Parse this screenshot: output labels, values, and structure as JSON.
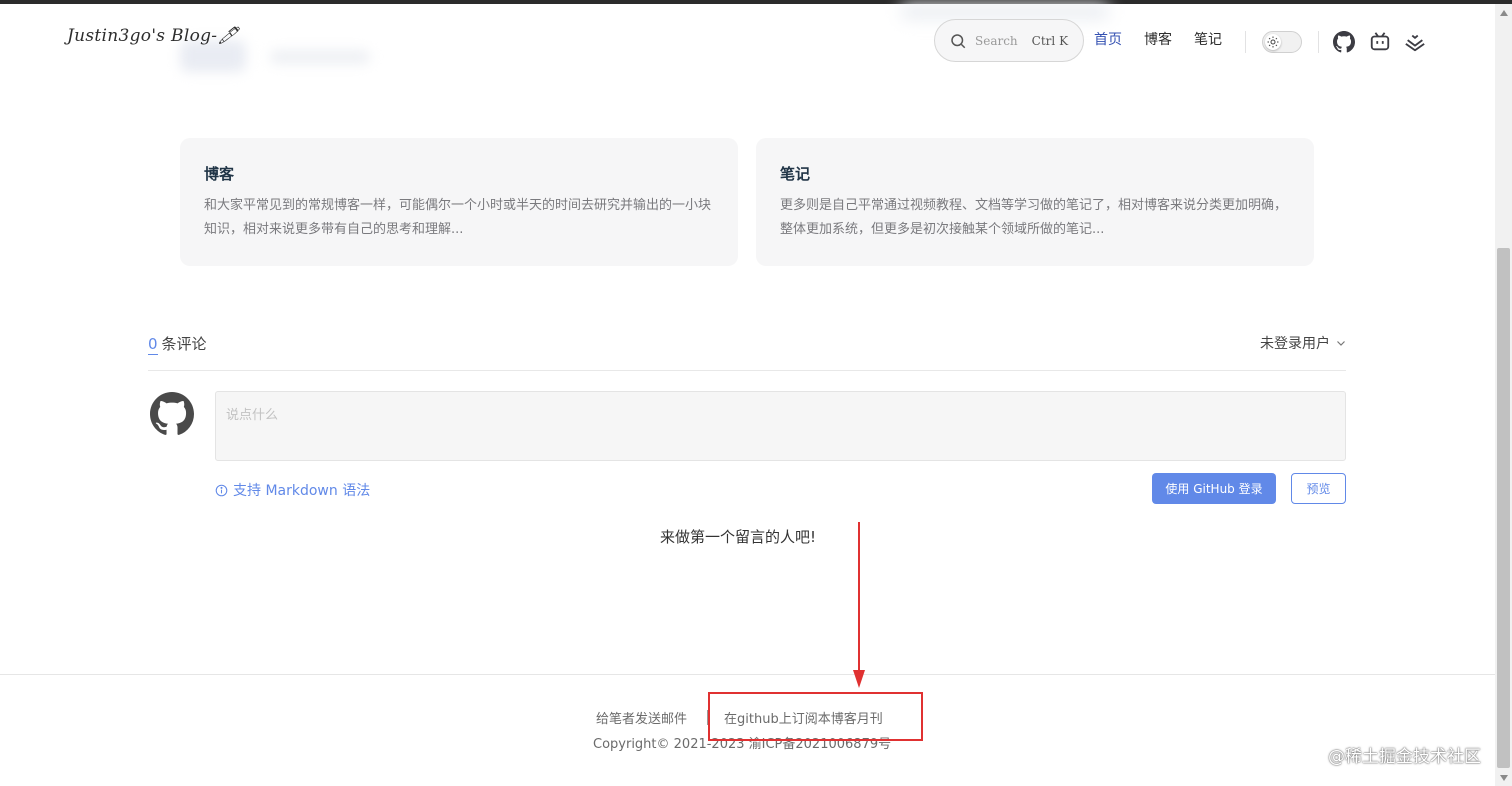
{
  "header": {
    "brand": "Justin3go's Blog-🖊",
    "search": {
      "placeholder": "Search",
      "shortcut": "Ctrl K"
    },
    "nav": [
      {
        "label": "首页",
        "active": true
      },
      {
        "label": "博客",
        "active": false
      },
      {
        "label": "笔记",
        "active": false
      }
    ],
    "icons": [
      "sun-icon",
      "github-icon",
      "bilibili-icon",
      "juejin-icon"
    ]
  },
  "cards": [
    {
      "title": "博客",
      "description": "和大家平常见到的常规博客一样，可能偶尔一个小时或半天的时间去研究并输出的一小块知识，相对来说更多带有自己的思考和理解..."
    },
    {
      "title": "笔记",
      "description": "更多则是自己平常通过视频教程、文档等学习做的笔记了，相对博客来说分类更加明确，整体更加系统，但更多是初次接触某个领域所做的笔记..."
    }
  ],
  "comments": {
    "count": "0",
    "count_label": "条评论",
    "user_menu": "未登录用户",
    "placeholder": "说点什么",
    "markdown_tip": "支持 Markdown 语法",
    "login_button": "使用 GitHub 登录",
    "preview_button": "预览",
    "empty_text": "来做第一个留言的人吧!"
  },
  "footer": {
    "email_link": "给笔者发送邮件",
    "subscribe_link": "在github上订阅本博客月刊",
    "copyright": "Copyright© 2021-2023 渝ICP备2021006879号"
  },
  "watermark": "@稀土掘金技术社区",
  "colors": {
    "accent": "#6189e8",
    "nav_active": "#3451b2",
    "annotation": "#e03131"
  }
}
